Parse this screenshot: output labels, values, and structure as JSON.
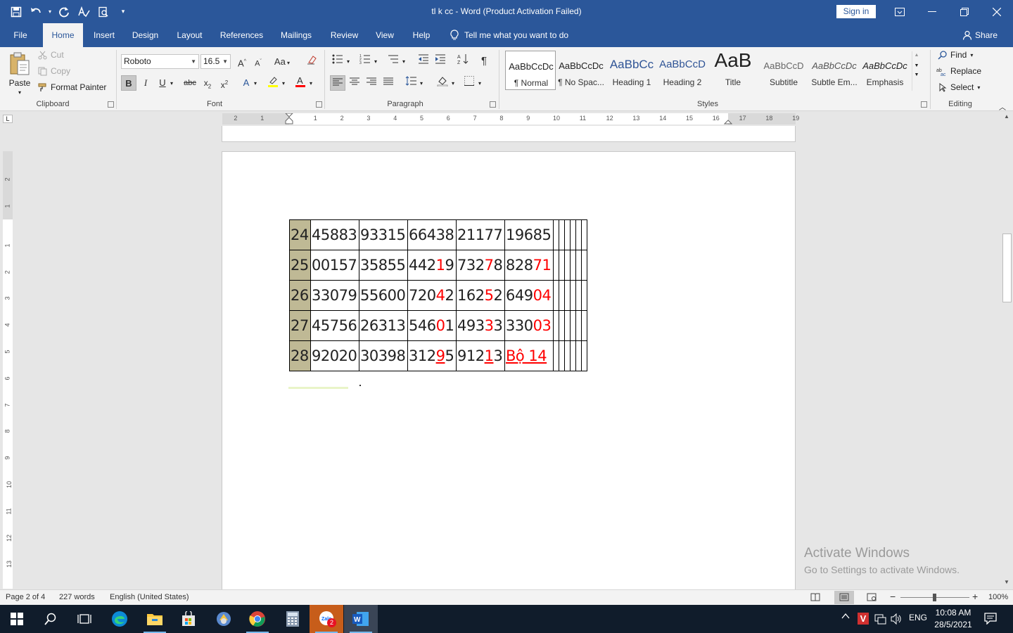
{
  "window": {
    "title": "tl k cc  -  Word (Product Activation Failed)",
    "signin": "Sign in"
  },
  "tabs": [
    "File",
    "Home",
    "Insert",
    "Design",
    "Layout",
    "References",
    "Mailings",
    "Review",
    "View",
    "Help"
  ],
  "active_tab": "Home",
  "tellme": "Tell me what you want to do",
  "share": "Share",
  "clipboard": {
    "paste": "Paste",
    "cut": "Cut",
    "copy": "Copy",
    "format_painter": "Format Painter",
    "group": "Clipboard"
  },
  "font": {
    "name": "Roboto",
    "size": "16.5",
    "group": "Font"
  },
  "paragraph": {
    "group": "Paragraph"
  },
  "styles": {
    "group": "Styles",
    "items": [
      {
        "sample": "AaBbCcDc",
        "name": "¶ Normal"
      },
      {
        "sample": "AaBbCcDc",
        "name": "¶ No Spac..."
      },
      {
        "sample": "AaBbCc",
        "name": "Heading 1"
      },
      {
        "sample": "AaBbCcD",
        "name": "Heading 2"
      },
      {
        "sample": "AaB",
        "name": "Title"
      },
      {
        "sample": "AaBbCcD",
        "name": "Subtitle"
      },
      {
        "sample": "AaBbCcDc",
        "name": "Subtle Em..."
      },
      {
        "sample": "AaBbCcDc",
        "name": "Emphasis"
      }
    ]
  },
  "editing": {
    "find": "Find",
    "replace": "Replace",
    "select": "Select",
    "group": "Editing"
  },
  "ruler": {
    "h_numbers": [
      "2",
      "1",
      "1",
      "2",
      "3",
      "4",
      "5",
      "6",
      "7",
      "8",
      "9",
      "10",
      "11",
      "12",
      "13",
      "14",
      "15",
      "16",
      "17",
      "18",
      "19"
    ],
    "v_numbers": [
      "2",
      "1",
      "1",
      "2",
      "3",
      "4",
      "5",
      "6",
      "7",
      "8",
      "9",
      "10",
      "11",
      "12",
      "13"
    ]
  },
  "table": {
    "rows": [
      {
        "num": "24",
        "cells": [
          [
            {
              "t": "45883"
            }
          ],
          [
            {
              "t": "93315"
            }
          ],
          [
            {
              "t": "66438"
            }
          ],
          [
            {
              "t": "21177"
            }
          ],
          [
            {
              "t": "19685"
            }
          ]
        ]
      },
      {
        "num": "25",
        "cells": [
          [
            {
              "t": "00157"
            }
          ],
          [
            {
              "t": "35855"
            }
          ],
          [
            {
              "t": "442"
            },
            {
              "t": "1",
              "red": true
            },
            {
              "t": "9"
            }
          ],
          [
            {
              "t": "732"
            },
            {
              "t": "7",
              "red": true
            },
            {
              "t": "8"
            }
          ],
          [
            {
              "t": "828"
            },
            {
              "t": "71",
              "red": true
            }
          ]
        ]
      },
      {
        "num": "26",
        "cells": [
          [
            {
              "t": "33079"
            }
          ],
          [
            {
              "t": "55600"
            }
          ],
          [
            {
              "t": "720"
            },
            {
              "t": "4",
              "red": true
            },
            {
              "t": "2"
            }
          ],
          [
            {
              "t": "162"
            },
            {
              "t": "5",
              "red": true
            },
            {
              "t": "2"
            }
          ],
          [
            {
              "t": "649"
            },
            {
              "t": "04",
              "red": true
            }
          ]
        ]
      },
      {
        "num": "27",
        "cells": [
          [
            {
              "t": "45756"
            }
          ],
          [
            {
              "t": "26313"
            }
          ],
          [
            {
              "t": "546"
            },
            {
              "t": "0",
              "red": true
            },
            {
              "t": "1"
            }
          ],
          [
            {
              "t": "493"
            },
            {
              "t": "3",
              "red": true
            },
            {
              "t": "3"
            }
          ],
          [
            {
              "t": "330"
            },
            {
              "t": "03",
              "red": true
            }
          ]
        ]
      },
      {
        "num": "28",
        "cells": [
          [
            {
              "t": "92020"
            }
          ],
          [
            {
              "t": "30398"
            }
          ],
          [
            {
              "t": "312"
            },
            {
              "t": "9",
              "red": true,
              "underline": true
            },
            {
              "t": "5"
            }
          ],
          [
            {
              "t": "912"
            },
            {
              "t": "1",
              "red": true,
              "underline": true
            },
            {
              "t": "3"
            }
          ],
          [
            {
              "t": " "
            },
            {
              "t": "Bộ 14",
              "red": true,
              "underline": true
            }
          ]
        ]
      }
    ]
  },
  "watermark": {
    "line1": "Activate Windows",
    "line2": "Go to Settings to activate Windows."
  },
  "status": {
    "page": "Page 2 of 4",
    "words": "227 words",
    "language": "English (United States)",
    "zoom": "100%"
  },
  "taskbar": {
    "lang": "ENG",
    "time": "10:08 AM",
    "date": "28/5/2021",
    "zalo_badge": "2"
  },
  "colors": {
    "accent": "#2b579a",
    "row_header": "#bfb995",
    "red_text": "#ff0000"
  }
}
